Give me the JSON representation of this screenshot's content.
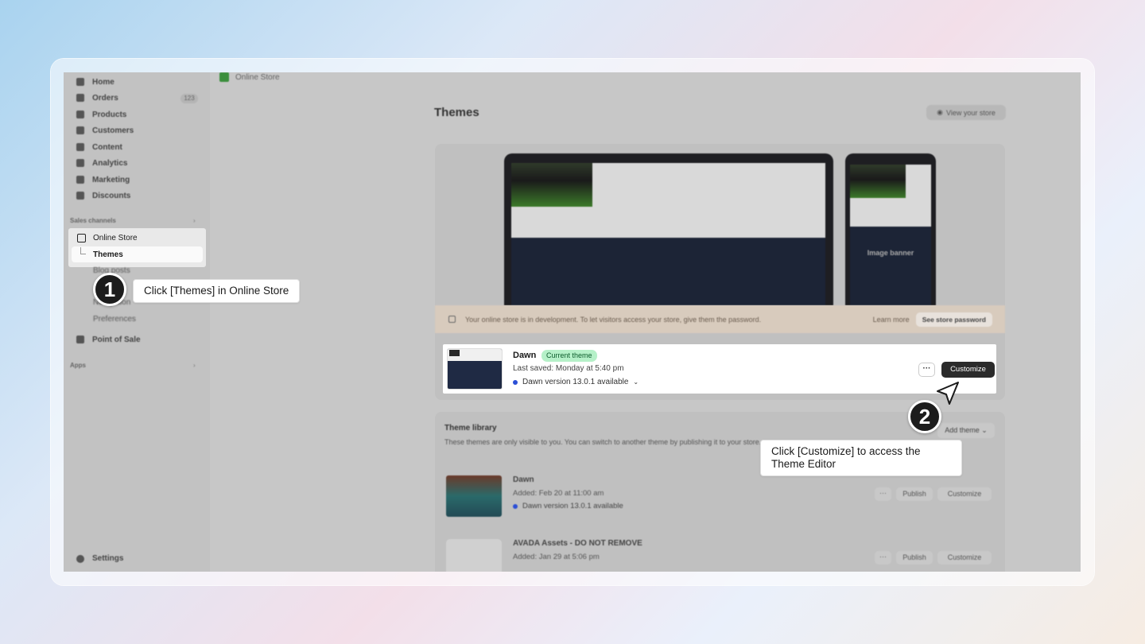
{
  "sidebar": {
    "items": [
      {
        "label": "Home",
        "icon": "home-icon"
      },
      {
        "label": "Orders",
        "icon": "orders-icon",
        "count": "123"
      },
      {
        "label": "Products",
        "icon": "products-icon"
      },
      {
        "label": "Customers",
        "icon": "customers-icon"
      },
      {
        "label": "Content",
        "icon": "content-icon"
      },
      {
        "label": "Analytics",
        "icon": "analytics-icon"
      },
      {
        "label": "Marketing",
        "icon": "marketing-icon"
      },
      {
        "label": "Discounts",
        "icon": "discounts-icon"
      }
    ],
    "sales_channels_label": "Sales channels",
    "online_store_label": "Online Store",
    "themes_label": "Themes",
    "blog_posts_label": "Blog posts",
    "navigation_label": "Navigation",
    "preferences_label": "Preferences",
    "point_of_sale_label": "Point of Sale",
    "apps_label": "Apps",
    "settings_label": "Settings",
    "chevron": "›"
  },
  "topbar": {
    "title": "Online Store"
  },
  "main": {
    "page_title": "Themes",
    "view_store_label": "View your store",
    "preview": {
      "phone_banner": "Image banner"
    },
    "dev_banner": {
      "message": "Your online store is in development. To let visitors access your store, give them the password.",
      "learn_more": "Learn more",
      "see_password": "See store password"
    },
    "current_theme": {
      "name": "Dawn",
      "badge": "Current theme",
      "last_saved": "Last saved: Monday at 5:40 pm",
      "version": "Dawn version 13.0.1 available",
      "more_label": "···",
      "customize_label": "Customize"
    },
    "library": {
      "title": "Theme library",
      "description": "These themes are only visible to you. You can switch to another theme by publishing it to your store.",
      "add_theme_label": "Add theme",
      "rows": [
        {
          "name": "Dawn",
          "added": "Added: Feb 20 at 11:00 am",
          "version": "Dawn version 13.0.1 available",
          "more": "···",
          "publish": "Publish",
          "customize": "Customize"
        },
        {
          "name": "AVADA Assets - DO NOT REMOVE",
          "added": "Added: Jan 29 at 5:06 pm",
          "more": "···",
          "publish": "Publish",
          "customize": "Customize"
        }
      ]
    }
  },
  "annotations": {
    "step1_number": "1",
    "step1_text": "Click [Themes] in Online Store",
    "step2_number": "2",
    "step2_text": "Click [Customize] to access the Theme Editor"
  },
  "colors": {
    "accent": "#2b2b2b",
    "badge_bg": "#b5f0c8",
    "badge_text": "#0d5c2c",
    "version_dot": "#2c4fd6"
  }
}
